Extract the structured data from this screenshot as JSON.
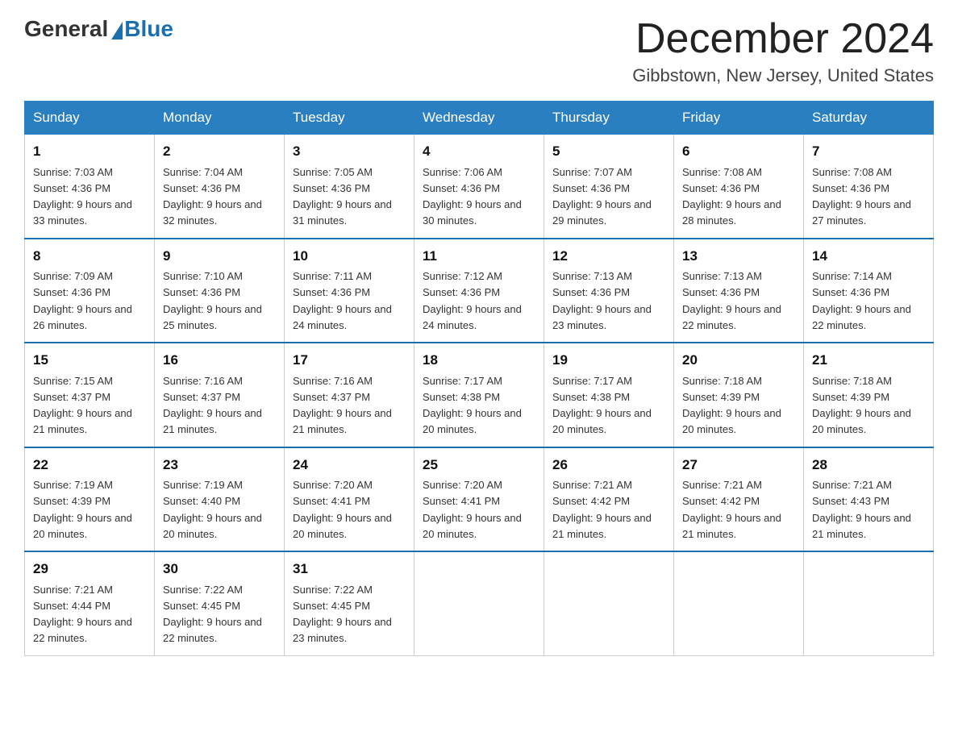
{
  "header": {
    "logo_general": "General",
    "logo_blue": "Blue",
    "month_title": "December 2024",
    "location": "Gibbstown, New Jersey, United States"
  },
  "days_of_week": [
    "Sunday",
    "Monday",
    "Tuesday",
    "Wednesday",
    "Thursday",
    "Friday",
    "Saturday"
  ],
  "weeks": [
    [
      {
        "day": "1",
        "sunrise": "7:03 AM",
        "sunset": "4:36 PM",
        "daylight": "9 hours and 33 minutes."
      },
      {
        "day": "2",
        "sunrise": "7:04 AM",
        "sunset": "4:36 PM",
        "daylight": "9 hours and 32 minutes."
      },
      {
        "day": "3",
        "sunrise": "7:05 AM",
        "sunset": "4:36 PM",
        "daylight": "9 hours and 31 minutes."
      },
      {
        "day": "4",
        "sunrise": "7:06 AM",
        "sunset": "4:36 PM",
        "daylight": "9 hours and 30 minutes."
      },
      {
        "day": "5",
        "sunrise": "7:07 AM",
        "sunset": "4:36 PM",
        "daylight": "9 hours and 29 minutes."
      },
      {
        "day": "6",
        "sunrise": "7:08 AM",
        "sunset": "4:36 PM",
        "daylight": "9 hours and 28 minutes."
      },
      {
        "day": "7",
        "sunrise": "7:08 AM",
        "sunset": "4:36 PM",
        "daylight": "9 hours and 27 minutes."
      }
    ],
    [
      {
        "day": "8",
        "sunrise": "7:09 AM",
        "sunset": "4:36 PM",
        "daylight": "9 hours and 26 minutes."
      },
      {
        "day": "9",
        "sunrise": "7:10 AM",
        "sunset": "4:36 PM",
        "daylight": "9 hours and 25 minutes."
      },
      {
        "day": "10",
        "sunrise": "7:11 AM",
        "sunset": "4:36 PM",
        "daylight": "9 hours and 24 minutes."
      },
      {
        "day": "11",
        "sunrise": "7:12 AM",
        "sunset": "4:36 PM",
        "daylight": "9 hours and 24 minutes."
      },
      {
        "day": "12",
        "sunrise": "7:13 AM",
        "sunset": "4:36 PM",
        "daylight": "9 hours and 23 minutes."
      },
      {
        "day": "13",
        "sunrise": "7:13 AM",
        "sunset": "4:36 PM",
        "daylight": "9 hours and 22 minutes."
      },
      {
        "day": "14",
        "sunrise": "7:14 AM",
        "sunset": "4:36 PM",
        "daylight": "9 hours and 22 minutes."
      }
    ],
    [
      {
        "day": "15",
        "sunrise": "7:15 AM",
        "sunset": "4:37 PM",
        "daylight": "9 hours and 21 minutes."
      },
      {
        "day": "16",
        "sunrise": "7:16 AM",
        "sunset": "4:37 PM",
        "daylight": "9 hours and 21 minutes."
      },
      {
        "day": "17",
        "sunrise": "7:16 AM",
        "sunset": "4:37 PM",
        "daylight": "9 hours and 21 minutes."
      },
      {
        "day": "18",
        "sunrise": "7:17 AM",
        "sunset": "4:38 PM",
        "daylight": "9 hours and 20 minutes."
      },
      {
        "day": "19",
        "sunrise": "7:17 AM",
        "sunset": "4:38 PM",
        "daylight": "9 hours and 20 minutes."
      },
      {
        "day": "20",
        "sunrise": "7:18 AM",
        "sunset": "4:39 PM",
        "daylight": "9 hours and 20 minutes."
      },
      {
        "day": "21",
        "sunrise": "7:18 AM",
        "sunset": "4:39 PM",
        "daylight": "9 hours and 20 minutes."
      }
    ],
    [
      {
        "day": "22",
        "sunrise": "7:19 AM",
        "sunset": "4:39 PM",
        "daylight": "9 hours and 20 minutes."
      },
      {
        "day": "23",
        "sunrise": "7:19 AM",
        "sunset": "4:40 PM",
        "daylight": "9 hours and 20 minutes."
      },
      {
        "day": "24",
        "sunrise": "7:20 AM",
        "sunset": "4:41 PM",
        "daylight": "9 hours and 20 minutes."
      },
      {
        "day": "25",
        "sunrise": "7:20 AM",
        "sunset": "4:41 PM",
        "daylight": "9 hours and 20 minutes."
      },
      {
        "day": "26",
        "sunrise": "7:21 AM",
        "sunset": "4:42 PM",
        "daylight": "9 hours and 21 minutes."
      },
      {
        "day": "27",
        "sunrise": "7:21 AM",
        "sunset": "4:42 PM",
        "daylight": "9 hours and 21 minutes."
      },
      {
        "day": "28",
        "sunrise": "7:21 AM",
        "sunset": "4:43 PM",
        "daylight": "9 hours and 21 minutes."
      }
    ],
    [
      {
        "day": "29",
        "sunrise": "7:21 AM",
        "sunset": "4:44 PM",
        "daylight": "9 hours and 22 minutes."
      },
      {
        "day": "30",
        "sunrise": "7:22 AM",
        "sunset": "4:45 PM",
        "daylight": "9 hours and 22 minutes."
      },
      {
        "day": "31",
        "sunrise": "7:22 AM",
        "sunset": "4:45 PM",
        "daylight": "9 hours and 23 minutes."
      },
      null,
      null,
      null,
      null
    ]
  ],
  "labels": {
    "sunrise_prefix": "Sunrise: ",
    "sunset_prefix": "Sunset: ",
    "daylight_prefix": "Daylight: "
  }
}
